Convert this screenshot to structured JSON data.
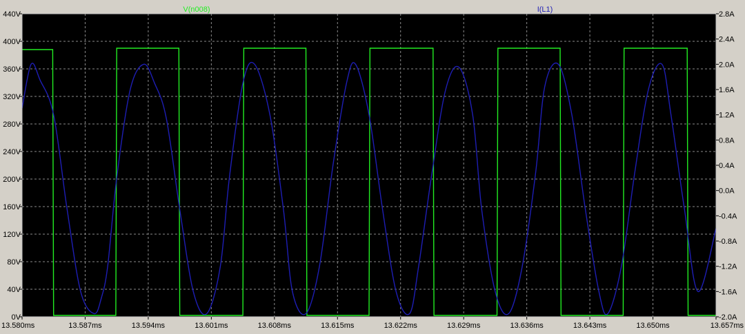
{
  "window": {
    "title_fragment": "V(n008)"
  },
  "chart_data": {
    "type": "line",
    "title": "",
    "x_unit": "ms",
    "x_ticks": [
      "13.580ms",
      "13.587ms",
      "13.594ms",
      "13.601ms",
      "13.608ms",
      "13.615ms",
      "13.622ms",
      "13.629ms",
      "13.636ms",
      "13.643ms",
      "13.650ms",
      "13.657ms"
    ],
    "xlim": [
      13.58,
      13.657
    ],
    "y_left_ticks": [
      "440V",
      "400V",
      "360V",
      "320V",
      "280V",
      "240V",
      "200V",
      "160V",
      "120V",
      "80V",
      "40V",
      "0V"
    ],
    "ylim_left": [
      0,
      440
    ],
    "y_right_ticks": [
      "2.8A",
      "2.4A",
      "2.0A",
      "1.6A",
      "1.2A",
      "0.8A",
      "0.4A",
      "0.0A",
      "-0.4A",
      "-0.8A",
      "-1.2A",
      "-1.6A",
      "-2.0A"
    ],
    "ylim_right": [
      -2.0,
      2.8
    ],
    "grid": true,
    "background": "#000000",
    "series": [
      {
        "name": "V(n008)",
        "axis": "left",
        "color": "#22ee22",
        "x": [
          13.58,
          13.5801,
          13.5802,
          13.5834,
          13.5835,
          13.5836,
          13.5904,
          13.5905,
          13.5906,
          13.5974,
          13.5975,
          13.5976,
          13.6045,
          13.6046,
          13.6047,
          13.6115,
          13.6116,
          13.6117,
          13.6185,
          13.6186,
          13.6187,
          13.6256,
          13.6257,
          13.6258,
          13.6327,
          13.6328,
          13.6329,
          13.6397,
          13.6398,
          13.6399,
          13.6467,
          13.6468,
          13.6469,
          13.6538,
          13.6539,
          13.654,
          13.657
        ],
        "y": [
          388,
          388,
          388,
          388,
          2,
          2,
          2,
          390,
          390,
          390,
          2,
          2,
          2,
          390,
          390,
          390,
          2,
          2,
          2,
          390,
          390,
          390,
          2,
          2,
          2,
          390,
          390,
          390,
          2,
          2,
          2,
          390,
          390,
          390,
          2,
          2,
          2
        ]
      },
      {
        "name": "I(L1)",
        "axis": "right",
        "color": "#1e1eb4",
        "x": [
          13.58,
          13.581,
          13.582,
          13.5835,
          13.585,
          13.5865,
          13.588,
          13.5888,
          13.5895,
          13.5905,
          13.592,
          13.5935,
          13.5947,
          13.596,
          13.5975,
          13.599,
          13.6005,
          13.602,
          13.603,
          13.6045,
          13.6058,
          13.6075,
          13.609,
          13.61,
          13.6115,
          13.613,
          13.6145,
          13.616,
          13.617,
          13.6185,
          13.62,
          13.6215,
          13.623,
          13.624,
          13.6255,
          13.627,
          13.6285,
          13.63,
          13.631,
          13.6325,
          13.634,
          13.6355,
          13.637,
          13.638,
          13.6395,
          13.641,
          13.6425,
          13.644,
          13.645,
          13.6465,
          13.648,
          13.6495,
          13.651,
          13.652,
          13.6535,
          13.655,
          13.657
        ],
        "y": [
          1.3,
          2.0,
          1.75,
          1.2,
          -0.3,
          -1.6,
          -1.95,
          -1.7,
          -1.2,
          0.2,
          1.6,
          2.0,
          1.7,
          1.15,
          -0.3,
          -1.6,
          -1.95,
          -1.2,
          0.2,
          1.7,
          2.0,
          1.2,
          -0.3,
          -1.6,
          -1.95,
          -1.2,
          0.4,
          1.7,
          2.0,
          1.2,
          -0.3,
          -1.6,
          -1.95,
          -1.2,
          0.3,
          1.6,
          1.95,
          1.2,
          -0.3,
          -1.6,
          -1.95,
          -1.2,
          0.3,
          1.65,
          2.0,
          1.2,
          -0.3,
          -1.6,
          -1.95,
          -1.2,
          0.3,
          1.6,
          2.0,
          1.2,
          -0.3,
          -1.6,
          -0.6
        ]
      }
    ]
  }
}
